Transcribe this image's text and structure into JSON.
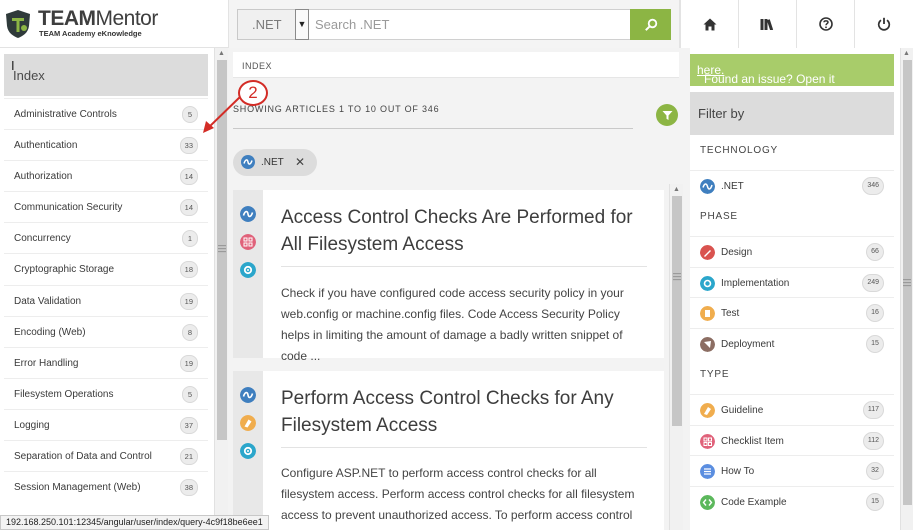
{
  "logo": {
    "title_bold": "TEAM",
    "title_light": "Mentor",
    "subtitle": "TEAM Academy eKnowledge"
  },
  "search": {
    "scope": ".NET",
    "placeholder": "Search .NET",
    "value": ""
  },
  "nav": [
    "home-icon",
    "library-icon",
    "help-icon",
    "logout-icon"
  ],
  "left": {
    "title": "Index",
    "items": [
      {
        "label": "Administrative Controls",
        "count": "5"
      },
      {
        "label": "Authentication",
        "count": "33"
      },
      {
        "label": "Authorization",
        "count": "14"
      },
      {
        "label": "Communication Security",
        "count": "14"
      },
      {
        "label": "Concurrency",
        "count": "1"
      },
      {
        "label": "Cryptographic Storage",
        "count": "18"
      },
      {
        "label": "Data Validation",
        "count": "19"
      },
      {
        "label": "Encoding (Web)",
        "count": "8"
      },
      {
        "label": "Error Handling",
        "count": "19"
      },
      {
        "label": "Filesystem Operations",
        "count": "5"
      },
      {
        "label": "Logging",
        "count": "37"
      },
      {
        "label": "Separation of Data and Control",
        "count": "21"
      },
      {
        "label": "Session Management (Web)",
        "count": "38"
      }
    ]
  },
  "middle": {
    "breadcrumb": "INDEX",
    "showing": "SHOWING ARTICLES 1 TO 10 OUT OF 346",
    "chip": ".NET",
    "articles": [
      {
        "title": "Access Control Checks Are Performed for All Filesystem Access",
        "summary": "Check if you have configured code access security policy in your web.config or machine.config files. Code Access Security Policy helps in limiting the amount of damage a badly written snippet of code ..."
      },
      {
        "title": "Perform Access Control Checks for Any Filesystem Access",
        "summary": "Configure ASP.NET to perform access control checks for all filesystem access. Perform access control checks for all filesystem access to prevent unauthorized access. To perform access control checks f ..."
      }
    ]
  },
  "right": {
    "issue_text": "Found an issue? Open it ",
    "issue_link": "here.",
    "filter_title": "Filter by",
    "technology_title": "TECHNOLOGY",
    "technology": [
      {
        "label": ".NET",
        "count": "346",
        "icon": "dotnet-icon",
        "color": "#3f7fbf"
      }
    ],
    "phase_title": "PHASE",
    "phase": [
      {
        "label": "Design",
        "count": "66",
        "icon": "design-icon",
        "color": "#d9534f"
      },
      {
        "label": "Implementation",
        "count": "249",
        "icon": "implementation-icon",
        "color": "#2ba6cb"
      },
      {
        "label": "Test",
        "count": "16",
        "icon": "test-icon",
        "color": "#f0ad4e"
      },
      {
        "label": "Deployment",
        "count": "15",
        "icon": "deployment-icon",
        "color": "#8c6e63"
      }
    ],
    "type_title": "TYPE",
    "type": [
      {
        "label": "Guideline",
        "count": "117",
        "icon": "guideline-icon",
        "color": "#f0ad4e"
      },
      {
        "label": "Checklist Item",
        "count": "112",
        "icon": "checklist-icon",
        "color": "#e0627a"
      },
      {
        "label": "How To",
        "count": "32",
        "icon": "howto-icon",
        "color": "#5b8ee0"
      },
      {
        "label": "Code Example",
        "count": "15",
        "icon": "code-example-icon",
        "color": "#5cb85c"
      }
    ]
  },
  "annotation": {
    "number": "2"
  },
  "status_url": "192.168.250.101:12345/angular/user/index/query-4c9f18be6ee1",
  "colors": {
    "accent": "#8cb544",
    "issue_bar": "#a8cc6a",
    "annotation": "#d32c26"
  }
}
